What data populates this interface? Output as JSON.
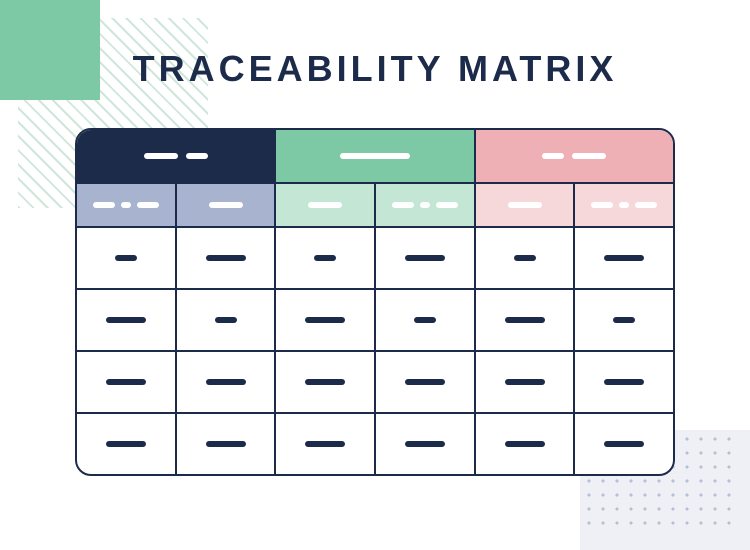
{
  "title": "TRACEABILITY MATRIX",
  "colors": {
    "navy": "#1d2b4b",
    "green": "#7ec9a5",
    "pink": "#eeb0b4",
    "blueLight": "#a7b3cf",
    "greenLight": "#c4e6d5",
    "pinkLight": "#f6d8da",
    "white": "#ffffff"
  },
  "groupHeaders": [
    {
      "label": "",
      "color": "navy",
      "pattern": [
        "med",
        "sm"
      ]
    },
    {
      "label": "",
      "color": "green",
      "pattern": [
        "long"
      ]
    },
    {
      "label": "",
      "color": "pink",
      "pattern": [
        "sm",
        "med"
      ]
    }
  ],
  "subHeaders": [
    {
      "label": "",
      "color": "blueLight",
      "pattern": [
        "sm",
        "tiny",
        "sm"
      ]
    },
    {
      "label": "",
      "color": "blueLight",
      "pattern": [
        "med"
      ]
    },
    {
      "label": "",
      "color": "greenLight",
      "pattern": [
        "med"
      ]
    },
    {
      "label": "",
      "color": "greenLight",
      "pattern": [
        "sm",
        "tiny",
        "sm"
      ]
    },
    {
      "label": "",
      "color": "pinkLight",
      "pattern": [
        "med"
      ]
    },
    {
      "label": "",
      "color": "pinkLight",
      "pattern": [
        "sm",
        "tiny",
        "sm"
      ]
    }
  ],
  "rows": [
    [
      "short",
      "long",
      "short",
      "long",
      "short",
      "long"
    ],
    [
      "long",
      "short",
      "long",
      "short",
      "long",
      "short"
    ],
    [
      "long",
      "long",
      "long",
      "long",
      "long",
      "long"
    ],
    [
      "long",
      "long",
      "long",
      "long",
      "long",
      "long"
    ]
  ]
}
